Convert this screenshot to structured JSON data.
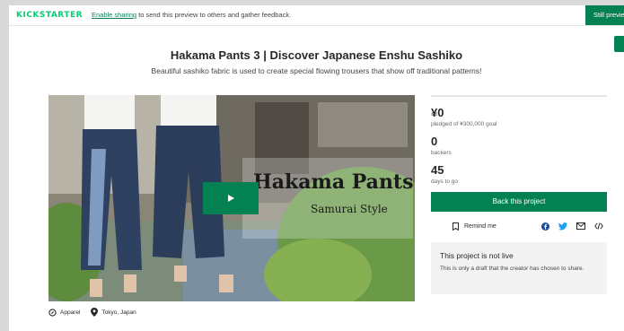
{
  "topbar": {
    "logo": "KICKSTARTER",
    "link": "Enable sharing",
    "notice_rest": " to send this preview to others and gather feedback.",
    "still_button": "Still previewing"
  },
  "project": {
    "title": "Hakama Pants 3 | Discover Japanese Enshu Sashiko",
    "subtitle": "Beautiful sashiko fabric is used to create special flowing trousers that show off traditional patterns!"
  },
  "hero": {
    "overlay_title": "Hakama Pants",
    "overlay_subtitle": "Samurai Style"
  },
  "meta": {
    "category": "Apparel",
    "location": "Tokyo, Japan"
  },
  "stats": {
    "pledged": "¥0",
    "pledged_label": "pledged of ¥300,000 goal",
    "backers": "0",
    "backers_label": "backers",
    "days": "45",
    "days_label": "days to go"
  },
  "actions": {
    "back_button": "Back this project",
    "remind": "Remind me",
    "share_icons": [
      "facebook-icon",
      "twitter-icon",
      "email-icon",
      "embed-icon"
    ]
  },
  "notice_box": {
    "title": "This project is not live",
    "text": "This is only a draft that the creator has chosen to share."
  },
  "colors": {
    "brand_green": "#038153",
    "logo_green": "#05ce78"
  }
}
